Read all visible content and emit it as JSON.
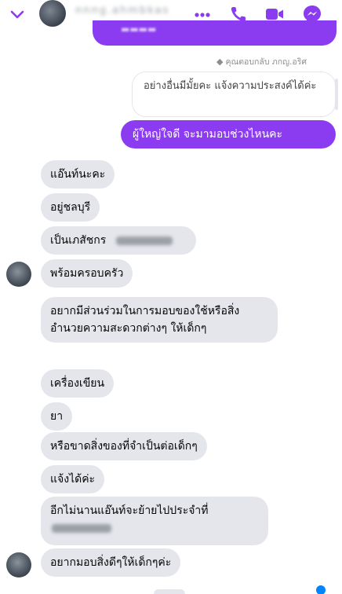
{
  "header": {
    "contact_name": "nnng.ahmbkas",
    "icons": [
      "chevron-down-icon",
      "more-icon",
      "phone-icon",
      "video-icon",
      "messenger-icon"
    ],
    "accent_color": "#8c3cf0"
  },
  "reply": {
    "note": "คุณตอบกลับ ภกญ.อริศ",
    "quoted_text": "อย่างอื่นมีมั้ยคะ แจ้งความประสงค์ได้ค่ะ"
  },
  "outgoing": {
    "message": "ผู้ใหญ่ใจดี จะมามอบช่วงไหนคะ"
  },
  "incoming": [
    "แอ๊นท์นะคะ",
    "อยู่ชลบุรี",
    "เป็นเภสัชกร",
    "พร้อมครอบครัว",
    "อยากมีส่วนร่วมในการมอบของใช้หรือสิ่งอำนวยความสะดวกต่างๆ ให้เด็กๆ",
    "เครื่องเขียน",
    "ยา",
    "หรือขาดสิ่งของที่จำเป็นต่อเด็กๆ",
    "แจ้งได้ค่ะ",
    "อีกไม่นานแอ๊นท์จะย้ายไปประจำที่",
    "อยากมอบสิ่งดีๆให้เด็กๆค่ะ"
  ]
}
